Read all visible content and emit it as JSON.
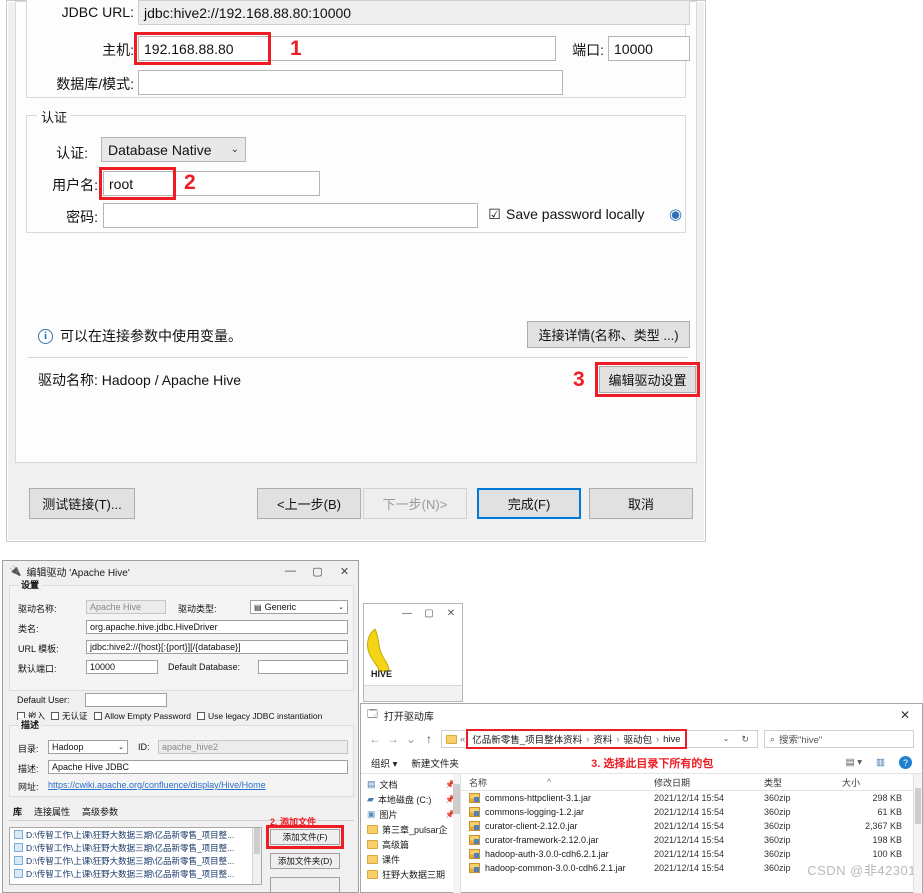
{
  "connection_dialog": {
    "jdbc_url_label": "JDBC URL:",
    "jdbc_url_value": "jdbc:hive2://192.168.88.80:10000",
    "host_label": "主机:",
    "host_value": "192.168.88.80",
    "host_marker": "1",
    "port_label": "端口:",
    "port_value": "10000",
    "database_label": "数据库/模式:",
    "database_value": "",
    "auth_group_title": "认证",
    "auth_label": "认证:",
    "auth_value": "Database Native",
    "username_label": "用户名:",
    "username_value": "root",
    "username_marker": "2",
    "password_label": "密码:",
    "password_value": "",
    "save_password_label": "Save password locally",
    "save_password_checked": "☑",
    "eye_icon": "◉",
    "info_icon": "i",
    "info_text": "可以在连接参数中使用变量。",
    "conn_details_button": "连接详情(名称、类型 ...)",
    "driver_name_label": "驱动名称:",
    "driver_name_value": "Hadoop / Apache Hive",
    "edit_driver_marker": "3",
    "edit_driver_button": "编辑驱动设置",
    "buttons": {
      "test": "测试链接(T)...",
      "back": "<上一步(B)",
      "next": "下一步(N)>",
      "finish": "完成(F)",
      "cancel": "取消"
    }
  },
  "driver_window": {
    "title": "编辑驱动 'Apache Hive'",
    "icon": "driver-icon",
    "minimize": "—",
    "maximize": "▢",
    "close": "✕",
    "settings_group": "设置",
    "driver_name_label": "驱动名称:",
    "driver_name_value": "Apache Hive",
    "driver_type_label": "驱动类型:",
    "driver_type_value": "Generic",
    "class_label": "类名:",
    "class_value": "org.apache.hive.jdbc.HiveDriver",
    "url_template_label": "URL 模板:",
    "url_template_value": "jdbc:hive2://{host}[:{port}][/{database}]",
    "default_port_label": "默认端口:",
    "default_port_value": "10000",
    "default_database_label": "Default Database:",
    "default_database_value": "",
    "default_user_label": "Default User:",
    "default_user_value": "",
    "checkboxes": [
      "嵌入",
      "无认证",
      "Allow Empty Password",
      "Use legacy JDBC instantiation"
    ],
    "desc_group": "描述",
    "category_label": "目录:",
    "category_value": "Hadoop",
    "id_label": "ID:",
    "id_value": "apache_hive2",
    "desc_label": "描述:",
    "desc_value": "Apache Hive JDBC",
    "url_label": "网址:",
    "url_value": "https://cwiki.apache.org/confluence/display/Hive/Home",
    "tabs": [
      "库",
      "连接属性",
      "高级参数"
    ],
    "active_tab": "库",
    "add_file_marker": "2. 添加文件",
    "lib_rows": [
      "D:\\传智工作\\上课\\狂野大数据三期\\亿品新零售_项目整...",
      "D:\\传智工作\\上课\\狂野大数据三期\\亿品新零售_项目整...",
      "D:\\传智工作\\上课\\狂野大数据三期\\亿品新零售_项目整...",
      "D:\\传智工作\\上课\\狂野大数据三期\\亿品新零售_项目整..."
    ],
    "side_buttons": [
      "添加文件(F)",
      "添加文件夹(D)"
    ]
  },
  "hive_window": {
    "minimize": "—",
    "maximize": "▢",
    "close": "✕",
    "logo_text": "HIVE"
  },
  "file_explorer": {
    "title": "打开驱动库",
    "close": "✕",
    "nav_back": "←",
    "nav_forward": "→",
    "nav_recent": "⌄",
    "nav_up": "↑",
    "breadcrumb": [
      "亿品新零售_项目整体资料",
      "资料",
      "驱动包",
      "hive"
    ],
    "breadcrumb_sep": "›",
    "dropdown": "⌄",
    "refresh": "↻",
    "search_icon": "search-icon",
    "search_placeholder": "搜索\"hive\"",
    "organize": "组织 ▾",
    "new_folder": "新建文件夹",
    "annotation": "3. 选择此目录下所有的包",
    "view_icon": "▤ ▾",
    "pane_icon": "▥",
    "help_icon": "?",
    "sidebar": [
      {
        "label": "文档",
        "icon": "document-icon",
        "pinned": true
      },
      {
        "label": "本地磁盘 (C:)",
        "icon": "disk-icon",
        "pinned": true
      },
      {
        "label": "图片",
        "icon": "picture-icon",
        "pinned": true
      },
      {
        "label": "第三章_pulsar企",
        "icon": "folder-icon",
        "pinned": false
      },
      {
        "label": "高级篇",
        "icon": "folder-icon",
        "pinned": false
      },
      {
        "label": "课件",
        "icon": "folder-icon",
        "pinned": false
      },
      {
        "label": "狂野大数据三期",
        "icon": "folder-icon",
        "pinned": false
      }
    ],
    "columns": [
      "名称",
      "修改日期",
      "类型",
      "大小"
    ],
    "sort_indicator": "^",
    "files": [
      {
        "name": "commons-httpclient-3.1.jar",
        "date": "2021/12/14 15:54",
        "type": "360zip",
        "size": "298 KB"
      },
      {
        "name": "commons-logging-1.2.jar",
        "date": "2021/12/14 15:54",
        "type": "360zip",
        "size": "61 KB"
      },
      {
        "name": "curator-client-2.12.0.jar",
        "date": "2021/12/14 15:54",
        "type": "360zip",
        "size": "2,367 KB"
      },
      {
        "name": "curator-framework-2.12.0.jar",
        "date": "2021/12/14 15:54",
        "type": "360zip",
        "size": "198 KB"
      },
      {
        "name": "hadoop-auth-3.0.0-cdh6.2.1.jar",
        "date": "2021/12/14 15:54",
        "type": "360zip",
        "size": "100 KB"
      },
      {
        "name": "hadoop-common-3.0.0-cdh6.2.1.jar",
        "date": "2021/12/14 15:54",
        "type": "360zip",
        "size": ""
      }
    ],
    "watermark": "CSDN @非42301"
  },
  "colors": {
    "accent_red": "#ee1c25",
    "link_blue": "#2a6fc9",
    "focus_blue": "#0078d7"
  }
}
